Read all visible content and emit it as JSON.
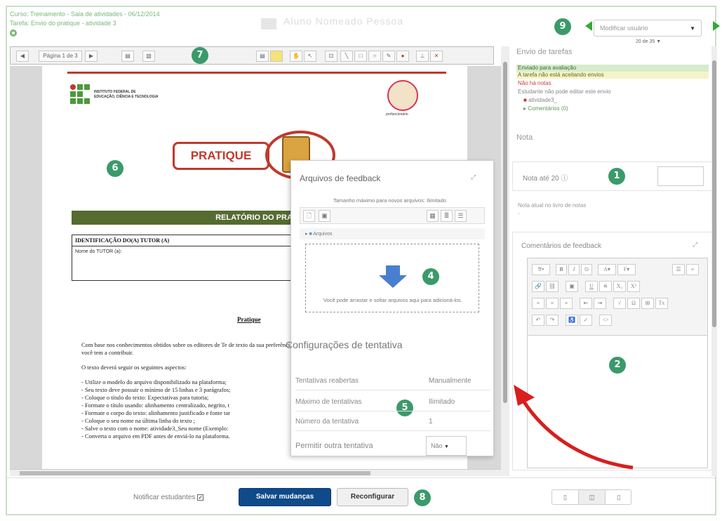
{
  "header": {
    "course_line": "Curso: Treinamento - Sala de atividades - 06/12/2014",
    "task_line": "Tarefa: Envio do pratique - atividade 3",
    "ghost_title": "Aluno Nomeado Pessoa"
  },
  "user_nav": {
    "user_select_placeholder": "Modificar usuário",
    "counter": "20 de 35"
  },
  "doc_toolbar": {
    "page_label": "Página 1 de 3"
  },
  "document": {
    "if_name_line1": "INSTITUTO FEDERAL DE",
    "if_name_line2": "EDUCAÇÃO, CIÊNCIA E TECNOLOGIA",
    "school_caption": "profuncionário",
    "pratique_label": "PRATIQUE",
    "report_title": "RELATÓRIO DO PRA",
    "ident_title": "IDENTIFICAÇÃO DO(A) TUTOR (A)",
    "tutor_name_label": "Nome do TUTOR (a):",
    "section_heading": "Pratique",
    "para1": "Com base nos conhecimentos obtidos sobre os editores de Te de texto da sua preferência tendo como base suas expectativa você espera aprender e o que você tem a contribuir.",
    "para2": "O texto deverá seguir os seguintes aspectos:",
    "items": [
      "- Utilize o modelo do arquivo disponibilizado na plataforma;",
      "- Seu texto deve possuir o mínimo de 15 linhas e 3 parágrafos;",
      "- Coloque o título do texto: Expectativas para tutoria;",
      "- Formate o título usando: alinhamento centralizado, negrito, t",
      "- Formate o corpo do texto: alinhamento justificado e fonte tar",
      "- Coloque o seu nome na última linha do texto ;",
      "- Salve o texto com o nome: atividade3_Seu nome (Exemplo:",
      "- Converta o arquivo em PDF antes de enviá-lo na plataforma."
    ]
  },
  "feedback_files": {
    "title": "Arquivos de feedback",
    "max_size": "Tamanho máximo para novos arquivos: Ilimitado",
    "folder": "Arquivos",
    "drop_text": "Você pode arrastar e soltar arquivos aqui para adicioná-los."
  },
  "attempt_settings": {
    "title": "Configurações de tentativa",
    "rows": [
      {
        "label": "Tentativas reabertas",
        "value": "Manualmente"
      },
      {
        "label": "Máximo de tentativas",
        "value": "Ilimitado"
      },
      {
        "label": "Número da tentativa",
        "value": "1"
      }
    ],
    "allow_label": "Permitir outra tentativa",
    "allow_value": "Não"
  },
  "sidebar": {
    "submission_title": "Envio de tarefas",
    "status_submitted": "Enviado para avaliação",
    "status_not_accepting": "A tarefa não está aceitando envios",
    "status_no_grades": "Não há notas",
    "status_cannot_edit": "Estudante não pode editar este envio",
    "file_name": "atividade3_",
    "comments_link": "Comentários (0)",
    "grade_section": "Nota",
    "grade_label": "Nota até 20",
    "current_grade_label": "Nota atual no livro de notas",
    "current_grade_value": "-",
    "feedback_comments_title": "Comentários de feedback"
  },
  "footer": {
    "notify_label": "Notificar estudantes",
    "save_label": "Salvar mudanças",
    "reset_label": "Reconfigurar"
  },
  "badges": {
    "b1": "1",
    "b2": "2",
    "b4": "4",
    "b5": "5",
    "b6": "6",
    "b7": "7",
    "b8": "8",
    "b9": "9"
  },
  "colors": {
    "accent_green": "#3b9a6a",
    "header_green": "#7ab87a",
    "save_blue": "#0f4a8a",
    "brand_red": "#c0392b"
  }
}
